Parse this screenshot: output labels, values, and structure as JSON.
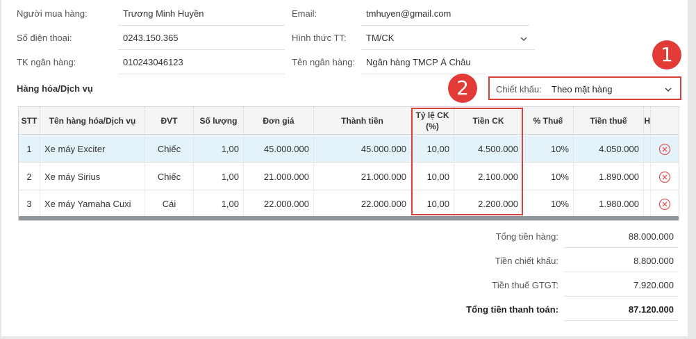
{
  "buyer": {
    "name_label": "Người mua hàng:",
    "name_value": "Trương Minh Huyền",
    "phone_label": "Số điện thoại:",
    "phone_value": "0243.150.365",
    "bank_acc_label": "TK ngân hàng:",
    "bank_acc_value": "010243046123",
    "email_label": "Email:",
    "email_value": "tmhuyen@gmail.com",
    "payment_label": "Hình thức TT:",
    "payment_value": "TM/CK",
    "bank_name_label": "Tên ngân hàng:",
    "bank_name_value": "Ngân hàng TMCP Á Châu"
  },
  "section_title": "Hàng hóa/Dịch vụ",
  "discount": {
    "label": "Chiết khấu:",
    "value": "Theo mặt hàng"
  },
  "callouts": [
    "1",
    "2"
  ],
  "table": {
    "headers": {
      "stt": "STT",
      "name": "Tên hàng hóa/Dịch vụ",
      "unit": "ĐVT",
      "qty": "Số lượng",
      "price": "Đơn giá",
      "amount": "Thành tiền",
      "ck_rate_1": "Tỷ lệ CK",
      "ck_rate_2": "(%)",
      "ck_amount": "Tiền CK",
      "vat_rate": "% Thuế",
      "vat_amount": "Tiền thuế",
      "extra": "H"
    },
    "rows": [
      {
        "stt": "1",
        "name": "Xe máy Exciter",
        "unit": "Chiếc",
        "qty": "1,00",
        "price": "45.000.000",
        "amount": "45.000.000",
        "ck_rate": "10,00",
        "ck_amount": "4.500.000",
        "vat_rate": "10%",
        "vat_amount": "4.050.000"
      },
      {
        "stt": "2",
        "name": "Xe máy Sirius",
        "unit": "Chiếc",
        "qty": "1,00",
        "price": "21.000.000",
        "amount": "21.000.000",
        "ck_rate": "10,00",
        "ck_amount": "2.100.000",
        "vat_rate": "10%",
        "vat_amount": "1.890.000"
      },
      {
        "stt": "3",
        "name": "Xe máy Yamaha Cuxi",
        "unit": "Cái",
        "qty": "1,00",
        "price": "22.000.000",
        "amount": "22.000.000",
        "ck_rate": "10,00",
        "ck_amount": "2.200.000",
        "vat_rate": "10%",
        "vat_amount": "1.980.000"
      }
    ]
  },
  "summary": {
    "goods_total_label": "Tổng tiền hàng:",
    "goods_total_value": "88.000.000",
    "discount_total_label": "Tiền chiết khấu:",
    "discount_total_value": "8.800.000",
    "vat_total_label": "Tiền thuế GTGT:",
    "vat_total_value": "7.920.000",
    "grand_total_label": "Tổng tiền thanh toán:",
    "grand_total_value": "87.120.000"
  },
  "colors": {
    "highlight_red": "#d9413d",
    "badge_red": "#e23b37",
    "selected_row": "#e4f3fa",
    "delete_icon": "#e05a5a"
  }
}
